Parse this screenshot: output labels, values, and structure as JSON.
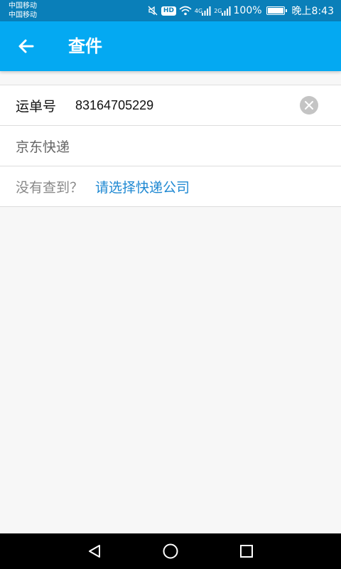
{
  "status_bar": {
    "carrier_1": "中国移动",
    "carrier_2": "中国移动",
    "hd_label": "HD",
    "net_1": "4G",
    "net_2": "2G",
    "battery": "100%",
    "time": "晚上8:43",
    "icons": [
      "mute-icon",
      "hd-icon",
      "wifi-icon",
      "signal-icon",
      "signal-icon",
      "battery-icon"
    ]
  },
  "appbar": {
    "back_icon": "arrow-left-icon",
    "title": "查件",
    "color": "#04a9f2"
  },
  "form": {
    "tracking_label": "运单号",
    "tracking_value": "83164705229",
    "clear_icon": "clear-circle-icon",
    "company": "京东快递",
    "not_found_hint": "没有查到？",
    "select_company_link": "请选择快递公司",
    "link_color": "#1e88d2"
  },
  "nav_bar": {
    "icons": [
      "back-triangle-icon",
      "home-circle-icon",
      "recents-square-icon"
    ]
  }
}
